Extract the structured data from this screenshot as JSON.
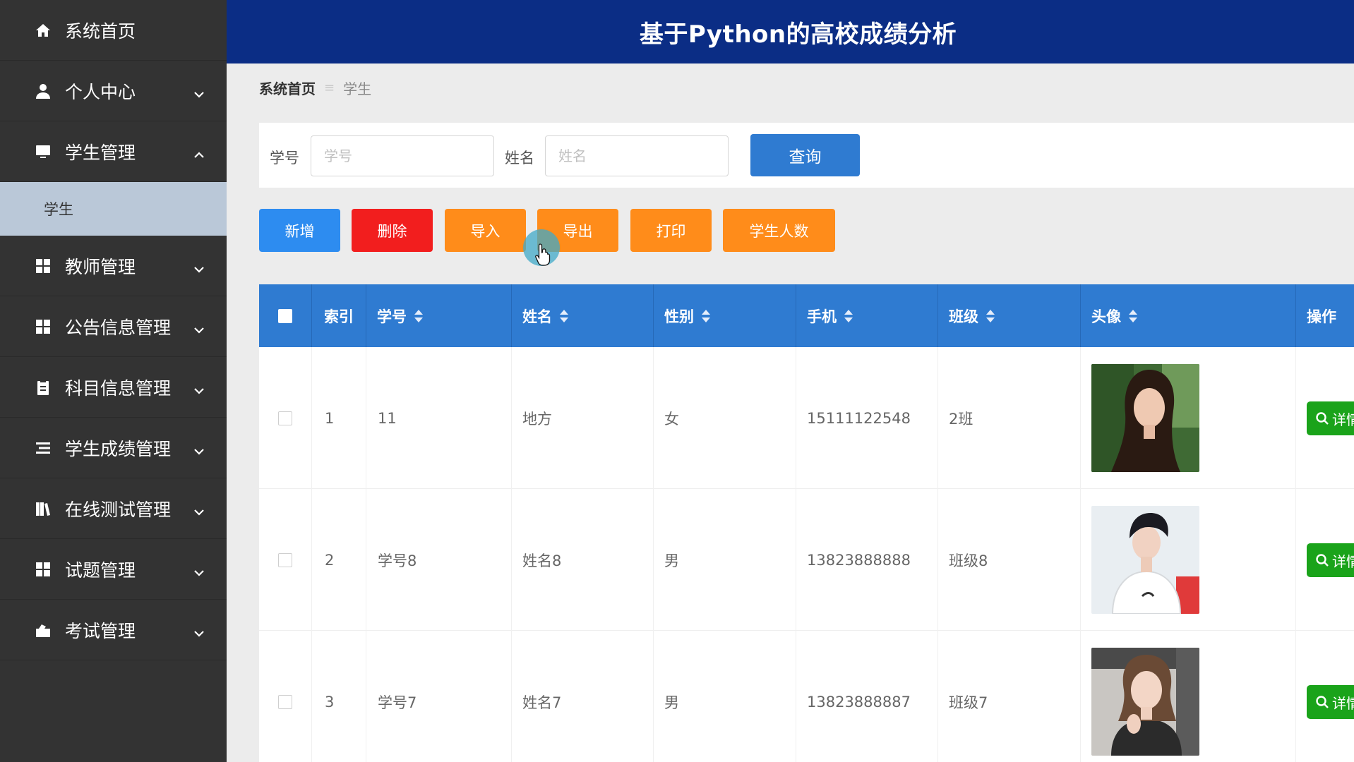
{
  "app": {
    "title": "基于Python的高校成绩分析"
  },
  "sidebar": {
    "items": [
      {
        "label": "系统首页",
        "icon": "home-icon",
        "has_chevron": false
      },
      {
        "label": "个人中心",
        "icon": "user-icon",
        "has_chevron": true,
        "expanded": false
      },
      {
        "label": "学生管理",
        "icon": "monitor-icon",
        "has_chevron": true,
        "expanded": true
      },
      {
        "label": "教师管理",
        "icon": "grid-icon",
        "has_chevron": true,
        "expanded": false
      },
      {
        "label": "公告信息管理",
        "icon": "grid-icon",
        "has_chevron": true,
        "expanded": false
      },
      {
        "label": "科目信息管理",
        "icon": "clipboard-icon",
        "has_chevron": true,
        "expanded": false
      },
      {
        "label": "学生成绩管理",
        "icon": "list-icon",
        "has_chevron": true,
        "expanded": false
      },
      {
        "label": "在线测试管理",
        "icon": "books-icon",
        "has_chevron": true,
        "expanded": false
      },
      {
        "label": "试题管理",
        "icon": "grid-icon",
        "has_chevron": true,
        "expanded": false
      },
      {
        "label": "考试管理",
        "icon": "briefcase-icon",
        "has_chevron": true,
        "expanded": false
      }
    ],
    "submenu": {
      "label": "学生"
    },
    "active_color": "#bac8d8"
  },
  "breadcrumb": {
    "home": "系统首页",
    "separator": "≡",
    "current": "学生"
  },
  "search": {
    "student_id_label": "学号",
    "student_id_placeholder": "学号",
    "name_label": "姓名",
    "name_placeholder": "姓名",
    "query_button": "查询"
  },
  "actions": {
    "add": "新增",
    "delete": "删除",
    "import": "导入",
    "export": "导出",
    "print": "打印",
    "student_count": "学生人数"
  },
  "colors": {
    "header_bg": "#0b2d85",
    "primary": "#2f7bd1",
    "add": "#2d8cf0",
    "danger": "#f21e1e",
    "warning": "#ff8c1a",
    "success": "#1aa31a"
  },
  "table": {
    "columns": [
      "索引",
      "学号",
      "姓名",
      "性别",
      "手机",
      "班级",
      "头像",
      "操作"
    ],
    "detail_label": "详情",
    "rows": [
      {
        "index": "1",
        "student_id": "11",
        "name": "地方",
        "gender": "女",
        "phone": "15111122548",
        "class": "2班",
        "avatar": "female-portrait"
      },
      {
        "index": "2",
        "student_id": "学号8",
        "name": "姓名8",
        "gender": "男",
        "phone": "13823888888",
        "class": "班级8",
        "avatar": "male-portrait"
      },
      {
        "index": "3",
        "student_id": "学号7",
        "name": "姓名7",
        "gender": "男",
        "phone": "13823888887",
        "class": "班级7",
        "avatar": "female-portrait"
      }
    ]
  }
}
